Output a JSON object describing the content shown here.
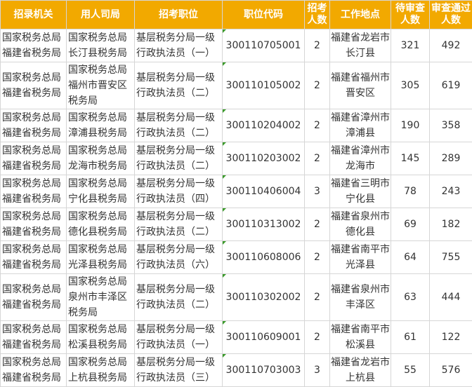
{
  "headers": [
    {
      "key": "agency",
      "label": "招录机关"
    },
    {
      "key": "employer",
      "label": "用人司局"
    },
    {
      "key": "position",
      "label": "招考职位"
    },
    {
      "key": "code",
      "label": "职位代码"
    },
    {
      "key": "num",
      "label": "招考人数"
    },
    {
      "key": "location",
      "label": "工作地点"
    },
    {
      "key": "pending",
      "label": "待审查人数"
    },
    {
      "key": "passed",
      "label": "审查通过人数"
    }
  ],
  "rows": [
    {
      "agency": "国家税务总局福建省税务局",
      "employer": "国家税务总局长汀县税务局",
      "position": "基层税务分局一级行政执法员（一）",
      "code": "300110705001",
      "num": "2",
      "location": "福建省龙岩市长汀县",
      "pending": "321",
      "passed": "492"
    },
    {
      "agency": "国家税务总局福建省税务局",
      "employer": "国家税务总局福州市晋安区税务局",
      "position": "基层税务分局一级行政执法员（二）",
      "code": "300110105002",
      "num": "2",
      "location": "福建省福州市晋安区",
      "pending": "305",
      "passed": "619"
    },
    {
      "agency": "国家税务总局福建省税务局",
      "employer": "国家税务总局漳浦县税务局",
      "position": "基层税务分局一级行政执法员（二）",
      "code": "300110204002",
      "num": "2",
      "location": "福建省漳州市漳浦县",
      "pending": "190",
      "passed": "358"
    },
    {
      "agency": "国家税务总局福建省税务局",
      "employer": "国家税务总局龙海市税务局",
      "position": "基层税务分局一级行政执法员（二）",
      "code": "300110203002",
      "num": "2",
      "location": "福建省漳州市龙海市",
      "pending": "145",
      "passed": "289"
    },
    {
      "agency": "国家税务总局福建省税务局",
      "employer": "国家税务总局宁化县税务局",
      "position": "基层税务分局一级行政执法员（四）",
      "code": "300110406004",
      "num": "3",
      "location": "福建省三明市宁化县",
      "pending": "78",
      "passed": "243"
    },
    {
      "agency": "国家税务总局福建省税务局",
      "employer": "国家税务总局德化县税务局",
      "position": "基层税务分局一级行政执法员（二）",
      "code": "300110313002",
      "num": "2",
      "location": "福建省泉州市德化县",
      "pending": "69",
      "passed": "182"
    },
    {
      "agency": "国家税务总局福建省税务局",
      "employer": "国家税务总局光泽县税务局",
      "position": "基层税务分局一级行政执法员（六）",
      "code": "300110608006",
      "num": "2",
      "location": "福建省南平市光泽县",
      "pending": "64",
      "passed": "755"
    },
    {
      "agency": "国家税务总局福建省税务局",
      "employer": "国家税务总局泉州市丰泽区税务局",
      "position": "基层税务分局一级行政执法员（二）",
      "code": "300110302002",
      "num": "2",
      "location": "福建省泉州市丰泽区",
      "pending": "63",
      "passed": "444"
    },
    {
      "agency": "国家税务总局福建省税务局",
      "employer": "国家税务总局松溪县税务局",
      "position": "基层税务分局一级行政执法员（一）",
      "code": "300110609001",
      "num": "2",
      "location": "福建省南平市松溪县",
      "pending": "61",
      "passed": "122"
    },
    {
      "agency": "国家税务总局福建省税务局",
      "employer": "国家税务总局上杭县税务局",
      "position": "基层税务分局一级行政执法员（三）",
      "code": "300110703003",
      "num": "3",
      "location": "福建省龙岩市上杭县",
      "pending": "55",
      "passed": "576"
    }
  ],
  "colors": {
    "header_bg": "#f2a900",
    "header_text": "#ffffff",
    "cell_text": "#333333",
    "grid": "#d6d6d6",
    "marker": "#3a9a2a"
  }
}
